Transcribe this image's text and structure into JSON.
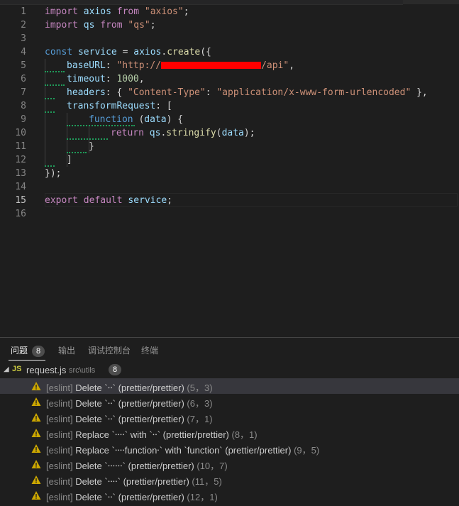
{
  "editor": {
    "active_line": 15,
    "lines": [
      {
        "n": "1"
      },
      {
        "n": "2"
      },
      {
        "n": "3"
      },
      {
        "n": "4"
      },
      {
        "n": "5"
      },
      {
        "n": "6"
      },
      {
        "n": "7"
      },
      {
        "n": "8"
      },
      {
        "n": "9"
      },
      {
        "n": "10"
      },
      {
        "n": "11"
      },
      {
        "n": "12"
      },
      {
        "n": "13"
      },
      {
        "n": "14"
      },
      {
        "n": "15"
      },
      {
        "n": "16"
      }
    ],
    "code": {
      "l1": {
        "kw1": "import",
        "id": " axios ",
        "kw2": "from",
        "sp": " ",
        "str": "\"axios\"",
        "end": ";"
      },
      "l2": {
        "kw1": "import",
        "id": " qs ",
        "kw2": "from",
        "sp": " ",
        "str": "\"qs\"",
        "end": ";"
      },
      "l4": {
        "kw": "const",
        "v": " service ",
        "eq": "= ",
        "obj": "axios",
        "dot": ".",
        "fn": "create",
        "rest": "({"
      },
      "l5": {
        "key": "baseURL",
        "colon": ": ",
        "s1": "\"http://",
        "s2": "/api\"",
        "comma": ","
      },
      "l6": {
        "key": "timeout",
        "colon": ": ",
        "num": "1000",
        "comma": ","
      },
      "l7": {
        "key": "headers",
        "p1": ": { ",
        "k": "\"Content-Type\"",
        "p2": ": ",
        "v": "\"application/x-www-form-urlencoded\"",
        "p3": " },"
      },
      "l8": {
        "key": "transformRequest",
        "rest": ": ["
      },
      "l9": {
        "kw": "function",
        "p1": " (",
        "param": "data",
        "p2": ") {"
      },
      "l10": {
        "kw": "return",
        "sp": " ",
        "obj": "qs",
        "dot": ".",
        "fn": "stringify",
        "p1": "(",
        "param": "data",
        "p2": ");"
      },
      "l11": {
        "t": "}"
      },
      "l12": {
        "t": "]"
      },
      "l13": {
        "t": "});"
      },
      "l15": {
        "kw1": "export",
        "sp1": " ",
        "kw2": "default",
        "sp2": " ",
        "id": "service",
        "end": ";"
      }
    }
  },
  "panel": {
    "tabs": [
      {
        "label": "问题",
        "badge": "8"
      },
      {
        "label": "输出"
      },
      {
        "label": "调试控制台"
      },
      {
        "label": "终端"
      }
    ],
    "file": {
      "icon": "JS",
      "name": "request.js",
      "path": "src\\utils",
      "count": "8"
    },
    "problems": [
      {
        "src": "[eslint]",
        "msg": " Delete `⸱⸱` (prettier/prettier)",
        "loc": " (5，3)"
      },
      {
        "src": "[eslint]",
        "msg": " Delete `⸱⸱` (prettier/prettier)",
        "loc": " (6，3)"
      },
      {
        "src": "[eslint]",
        "msg": " Delete `⸱⸱` (prettier/prettier)",
        "loc": " (7，1)"
      },
      {
        "src": "[eslint]",
        "msg": " Replace `⸱⸱⸱⸱` with `⸱⸱` (prettier/prettier)",
        "loc": " (8，1)"
      },
      {
        "src": "[eslint]",
        "msg": " Replace `⸱⸱⸱⸱function⸱` with `function` (prettier/prettier)",
        "loc": " (9，5)"
      },
      {
        "src": "[eslint]",
        "msg": " Delete `⸱⸱⸱⸱⸱⸱` (prettier/prettier)",
        "loc": " (10，7)"
      },
      {
        "src": "[eslint]",
        "msg": " Delete `⸱⸱⸱⸱` (prettier/prettier)",
        "loc": " (11，5)"
      },
      {
        "src": "[eslint]",
        "msg": " Delete `⸱⸱` (prettier/prettier)",
        "loc": " (12，1)"
      }
    ]
  },
  "colors": {
    "keyword": "#c586c0",
    "storage": "#569cd6",
    "variable": "#9cdcfe",
    "function": "#dcdcaa",
    "string": "#ce9178",
    "number": "#b5cea8",
    "warning": "#cca700",
    "squiggle": "#1f9c5a"
  },
  "icons": {
    "warning": "warning-icon",
    "chevron": "chevron-down-icon",
    "file": "js-file-icon"
  }
}
